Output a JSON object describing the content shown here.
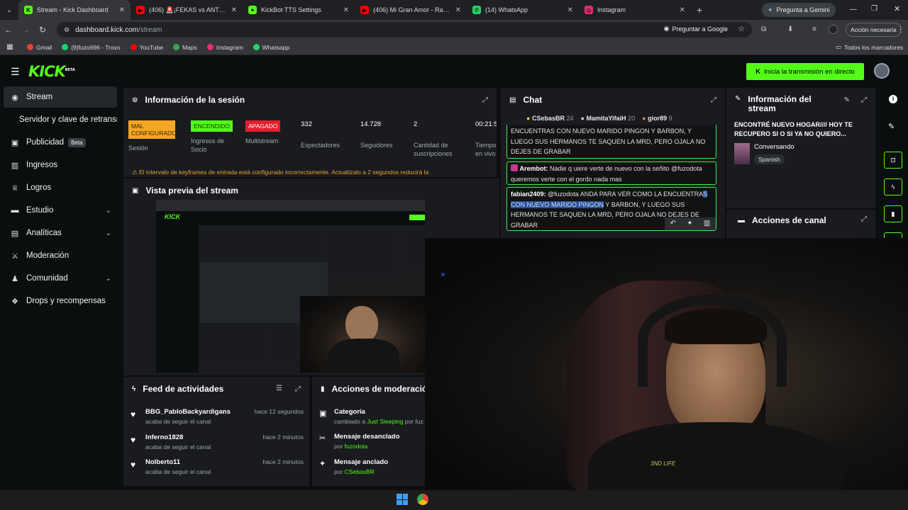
{
  "browser": {
    "tabs": [
      {
        "label": "Stream - Kick Dashboard",
        "icon_color": "#53fc18",
        "icon_glyph": "K",
        "active": true
      },
      {
        "label": "(406) 🚨¡FEKAS vs ANTIFEKAS!🚨",
        "icon_color": "#ff0000",
        "icon_glyph": "▶",
        "active": false
      },
      {
        "label": "KickBot TTS Settings",
        "icon_color": "#53fc18",
        "icon_glyph": "✦",
        "active": false
      },
      {
        "label": "(406) Mi Gran Amor - Rapper School",
        "icon_color": "#ff0000",
        "icon_glyph": "▶",
        "active": false
      },
      {
        "label": "(14) WhatsApp",
        "icon_color": "#25d366",
        "icon_glyph": "✆",
        "active": false
      },
      {
        "label": "Instagram",
        "icon_color": "#e1306c",
        "icon_glyph": "◎",
        "active": false
      }
    ],
    "gemini_button": "Pregunta a Gemini",
    "url_host": "dashboard.kick.com",
    "url_path": "/stream",
    "ask_google": "Preguntar a Google",
    "action_required": "Acción necesaria",
    "bookmarks": [
      {
        "label": "Gmail",
        "color": "#ea4335"
      },
      {
        "label": "(9)fuzo696 - Trovo",
        "color": "#19d66b"
      },
      {
        "label": "YouTube",
        "color": "#ff0000"
      },
      {
        "label": "Maps",
        "color": "#34a853"
      },
      {
        "label": "Instagram",
        "color": "#e1306c"
      },
      {
        "label": "Whatsapp",
        "color": "#25d366"
      }
    ],
    "all_bookmarks": "Todos los marcadores"
  },
  "header": {
    "logo": "KICK",
    "logo_sup": "BETA",
    "go_live": "Inicia la transmisión en directo",
    "accent": "#53fc18"
  },
  "sidebar": {
    "items": [
      {
        "label": "Stream",
        "icon": "stream-icon"
      },
      {
        "label": "Servidor y clave de retransmisión"
      },
      {
        "label": "Publicidad",
        "badge": "Beta"
      },
      {
        "label": "Ingresos"
      },
      {
        "label": "Logros"
      },
      {
        "label": "Estudio"
      },
      {
        "label": "Analíticas"
      },
      {
        "label": "Moderación"
      },
      {
        "label": "Comunidad"
      },
      {
        "label": "Drops y recompensas"
      }
    ]
  },
  "session": {
    "title": "Información de la sesión",
    "stats": [
      {
        "value": "MAL CONFIGURADO",
        "label": "Sesión",
        "badge_color": "#f5a623"
      },
      {
        "value": "ENCENDIDO",
        "label": "Ingresos de Socio",
        "badge_color": "#53fc18"
      },
      {
        "value": "APAGADO",
        "label": "Multistream",
        "badge_color": "#e0202e"
      },
      {
        "value": "332",
        "label": "Espectadores"
      },
      {
        "value": "14.728",
        "label": "Seguidores"
      },
      {
        "value": "2",
        "label": "Cantidad de suscripciones"
      },
      {
        "value": "00:21:5",
        "label": "Tiempo en vivo"
      }
    ],
    "warning": "El intervalo de keyframes de entrada está configurado incorrectamente. Actualízalo a 2 segundos reducirá la"
  },
  "preview": {
    "title": "Vista previa del stream"
  },
  "chat": {
    "title": "Chat",
    "top_users": [
      {
        "name": "CSebasBR",
        "count": "24",
        "color": "#f5c518"
      },
      {
        "name": "MamitaYifaiH",
        "count": "20",
        "color": "#cccccc"
      },
      {
        "name": "gior89",
        "count": "9",
        "color": "#e08a3a"
      }
    ],
    "msg1": "ENCUENTRAS CON NUEVO MARIDO PINGON Y BARBON, Y LUEGO SUS HERMANOS TE SAQUEN LA MRD, PERO OJALA NO DEJES DE GRABAR",
    "msg2_user": "Arembot:",
    "msg2": "Nadie q uiere verte de nuevo con la señito @fuzodota queremos verte con el gordo nada mas",
    "msg3_user": "fabian2409:",
    "msg3_a": "@fuzodota ANDA PARA VER COMO LA ENCUENTRA",
    "msg3_hl": "S CON NUEVO MARIDO PINGON",
    "msg3_b": " Y BARBON, Y LUEGO SUS HERMANOS TE SAQUEN LA MRD, PERO OJALA NO DEJES DE GRABAR"
  },
  "stream_info": {
    "title": "Información del stream",
    "stream_title": "ENCONTRÉ NUEVO HOGAR//// HOY TE RECUPERO SI O SI YA NO QUIERO...",
    "category": "Conversando",
    "language": "Spanish"
  },
  "channel_actions": {
    "title": "Acciones de canal"
  },
  "activity": {
    "title": "Feed de actividades",
    "items": [
      {
        "name": "BBG_PabloBackyardigans",
        "sub": "acaba de seguir el canal",
        "time": "hace 12 segundos"
      },
      {
        "name": "Inferno1828",
        "sub": "acaba de seguir el canal",
        "time": "hace 2 minutos"
      },
      {
        "name": "Nolberto11",
        "sub": "acaba de seguir el canal",
        "time": "hace 2 minutos"
      }
    ]
  },
  "moderation": {
    "title": "Acciones de moderación",
    "items": [
      {
        "name": "Categoría",
        "pre": "cambiado a ",
        "target": "Just Sleeping",
        "post": " por fuz"
      },
      {
        "name": "Mensaje desanclado",
        "pre": "por ",
        "target": "fuzodota",
        "post": ""
      },
      {
        "name": "Mensaje anclado",
        "pre": "por ",
        "target": "CSebasBR",
        "post": ""
      }
    ]
  }
}
